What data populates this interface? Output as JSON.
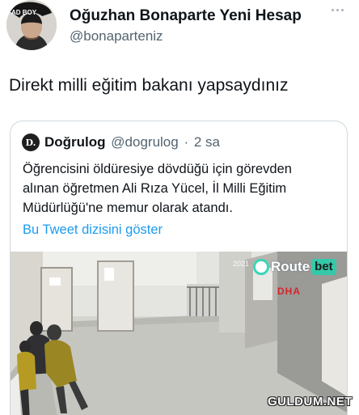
{
  "tweet": {
    "author_name": "Oğuzhan Bonaparte Yeni Hesap",
    "author_handle": "@bonaparteniz",
    "avatar_cap_text": "AD BOY",
    "text": "Direkt milli eğitim bakanı yapsaydınız"
  },
  "quote": {
    "avatar_letter": "D.",
    "name": "Doğrulog",
    "handle": "@dogrulog",
    "separator": "·",
    "time": "2 sa",
    "lines": [
      "Öğrencisini öldüresiye dövdüğü için görevden",
      "alınan öğretmen Ali Rıza Yücel, İl Milli Eğitim",
      "Müdürlüğü'ne memur olarak atandı."
    ],
    "show_thread": "Bu Tweet dizisini göster"
  },
  "video": {
    "timestamp": "2021",
    "sponsor_route": "Route",
    "sponsor_bet": "bet",
    "agency": "DHA"
  },
  "watermark": "GULDUM.NET",
  "colors": {
    "link": "#1d9bf0",
    "secondary_text": "#536471",
    "border": "#cfd9de",
    "agency_red": "#d4252a",
    "sponsor_green": "#34c9a8"
  }
}
